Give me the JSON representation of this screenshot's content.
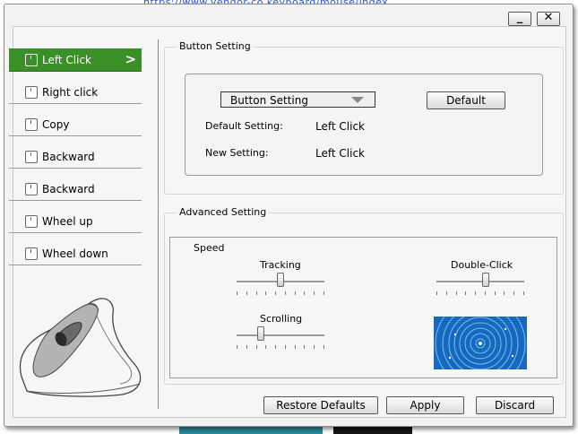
{
  "background": {
    "top_text": "https://www.vendor-co.keyboard/mouse/index"
  },
  "window": {
    "minimize_label": "_",
    "close_label": "✕"
  },
  "sidebar": {
    "items": [
      {
        "label": "Left Click",
        "active": true
      },
      {
        "label": "Right click",
        "active": false
      },
      {
        "label": "Copy",
        "active": false
      },
      {
        "label": "Backward",
        "active": false
      },
      {
        "label": "Backward",
        "active": false
      },
      {
        "label": "Wheel up",
        "active": false
      },
      {
        "label": "Wheel down",
        "active": false
      }
    ],
    "chevron": ">"
  },
  "button_setting": {
    "title": "Button Setting",
    "select_value": "Button Setting",
    "default_button": "Default",
    "default_setting_label": "Default Setting:",
    "default_setting_value": "Left Click",
    "new_setting_label": "New Setting:",
    "new_setting_value": "Left Click"
  },
  "advanced_setting": {
    "title": "Advanced Setting",
    "speed_label": "Speed",
    "tracking_label": "Tracking",
    "tracking_level": 0.5,
    "double_click_label": "Double-Click",
    "double_click_level": 0.57,
    "scrolling_label": "Scrolling",
    "scrolling_level": 0.25
  },
  "footer": {
    "restore_defaults": "Restore Defaults",
    "apply": "Apply",
    "discard": "Discard"
  },
  "colors": {
    "accent": "#3a8f27",
    "preview": "#1a74c8"
  }
}
